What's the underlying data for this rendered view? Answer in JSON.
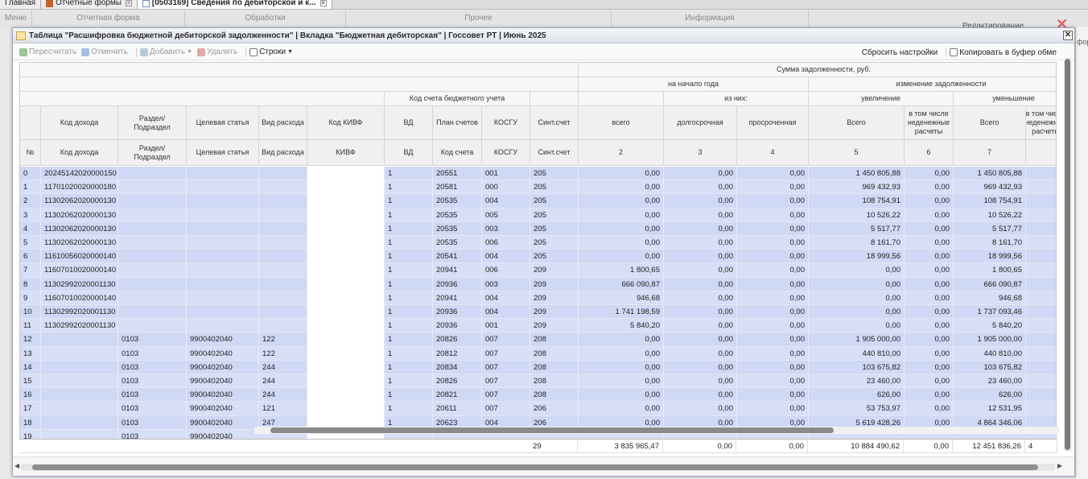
{
  "top_tabs": [
    {
      "label": "Главная",
      "icon": "home-icon"
    },
    {
      "label": "Отчетные формы",
      "icon": "folder-icon"
    },
    {
      "label": "[0503169] Сведения по дебиторской и к...",
      "icon": "document-icon"
    }
  ],
  "menubar": [
    "Меню",
    "Отчетная форма",
    "Обработки",
    "Прочее",
    "Информация"
  ],
  "background": {
    "edit_label": "Редактирование",
    "right_text": "форм"
  },
  "window": {
    "title": "Таблица \"Расшифровка бюджетной дебиторской задолженности\" | Вкладка \"Бюджетная дебиторская\" | Госсовет РТ | Июнь 2025",
    "close_label": "✕"
  },
  "toolbar": {
    "recalc": "Пересчитать",
    "cancel": "Отменить",
    "add": "Добавить",
    "delete": "Удалить",
    "rows": "Строки",
    "reset": "Сбросить настройки",
    "copy": "Копировать в буфер обме"
  },
  "header": {
    "sum_group": "Сумма задолженности, руб.",
    "start_year": "на начало года",
    "change": "изменение задолженности",
    "account_code": "Код счета бюджетного учета",
    "of_which": "из них:",
    "increase": "увеличение",
    "decrease": "уменьшение",
    "cols": [
      "",
      "Код дохода",
      "Раздел/ Подраздел",
      "Целевая статья",
      "Вид расхода",
      "Код КИВФ",
      "ВД",
      "План счетов",
      "КОСГУ",
      "Синт.счет",
      "всего",
      "долгосрочная",
      "просроченная",
      "Всего",
      "в том числе неденежные расчеты",
      "Всего",
      "в том числе неденежные расчеты"
    ],
    "codes": [
      "№",
      "Код дохода",
      "Раздел/ Подраздел",
      "Целевая статья",
      "Вид расхода",
      "КИВФ",
      "ВД",
      "Код счета",
      "КОСГУ",
      "Синт.счет",
      "2",
      "3",
      "4",
      "5",
      "6",
      "7",
      ""
    ]
  },
  "rows": [
    [
      "0",
      "20245142020000150",
      "",
      "",
      "",
      "",
      "1",
      "20551",
      "001",
      "205",
      "0,00",
      "0,00",
      "0,00",
      "1 450 805,88",
      "0,00",
      "1 450 805,88"
    ],
    [
      "1",
      "11701020020000180",
      "",
      "",
      "",
      "",
      "1",
      "20581",
      "000",
      "205",
      "0,00",
      "0,00",
      "0,00",
      "969 432,93",
      "0,00",
      "969 432,93"
    ],
    [
      "2",
      "11302062020000130",
      "",
      "",
      "",
      "",
      "1",
      "20535",
      "004",
      "205",
      "0,00",
      "0,00",
      "0,00",
      "108 754,91",
      "0,00",
      "108 754,91"
    ],
    [
      "3",
      "11302062020000130",
      "",
      "",
      "",
      "",
      "1",
      "20535",
      "005",
      "205",
      "0,00",
      "0,00",
      "0,00",
      "10 526,22",
      "0,00",
      "10 526,22"
    ],
    [
      "4",
      "11302062020000130",
      "",
      "",
      "",
      "",
      "1",
      "20535",
      "003",
      "205",
      "0,00",
      "0,00",
      "0,00",
      "5 517,77",
      "0,00",
      "5 517,77"
    ],
    [
      "5",
      "11302062020000130",
      "",
      "",
      "",
      "",
      "1",
      "20535",
      "006",
      "205",
      "0,00",
      "0,00",
      "0,00",
      "8 161,70",
      "0,00",
      "8 161,70"
    ],
    [
      "6",
      "11610056020000140",
      "",
      "",
      "",
      "",
      "1",
      "20541",
      "004",
      "205",
      "0,00",
      "0,00",
      "0,00",
      "18 999,56",
      "0,00",
      "18 999,56"
    ],
    [
      "7",
      "11607010020000140",
      "",
      "",
      "",
      "",
      "1",
      "20941",
      "006",
      "209",
      "1 800,65",
      "0,00",
      "0,00",
      "0,00",
      "0,00",
      "1 800,65"
    ],
    [
      "8",
      "11302992020001130",
      "",
      "",
      "",
      "",
      "1",
      "20936",
      "003",
      "209",
      "666 090,87",
      "0,00",
      "0,00",
      "0,00",
      "0,00",
      "666 090,87"
    ],
    [
      "9",
      "11607010020000140",
      "",
      "",
      "",
      "",
      "1",
      "20941",
      "004",
      "209",
      "946,68",
      "0,00",
      "0,00",
      "0,00",
      "0,00",
      "946,68"
    ],
    [
      "10",
      "11302992020001130",
      "",
      "",
      "",
      "",
      "1",
      "20936",
      "004",
      "209",
      "1 741 198,59",
      "0,00",
      "0,00",
      "0,00",
      "0,00",
      "1 737 093,46"
    ],
    [
      "11",
      "11302992020001130",
      "",
      "",
      "",
      "",
      "1",
      "20936",
      "001",
      "209",
      "5 840,20",
      "0,00",
      "0,00",
      "0,00",
      "0,00",
      "5 840,20"
    ],
    [
      "12",
      "",
      "0103",
      "9900402040",
      "122",
      "",
      "1",
      "20826",
      "007",
      "208",
      "0,00",
      "0,00",
      "0,00",
      "1 905 000,00",
      "0,00",
      "1 905 000,00"
    ],
    [
      "13",
      "",
      "0103",
      "9900402040",
      "122",
      "",
      "1",
      "20812",
      "007",
      "208",
      "0,00",
      "0,00",
      "0,00",
      "440 810,00",
      "0,00",
      "440 810,00"
    ],
    [
      "14",
      "",
      "0103",
      "9900402040",
      "244",
      "",
      "1",
      "20834",
      "007",
      "208",
      "0,00",
      "0,00",
      "0,00",
      "103 675,82",
      "0,00",
      "103 675,82"
    ],
    [
      "15",
      "",
      "0103",
      "9900402040",
      "244",
      "",
      "1",
      "20826",
      "007",
      "208",
      "0,00",
      "0,00",
      "0,00",
      "23 460,00",
      "0,00",
      "23 460,00"
    ],
    [
      "16",
      "",
      "0103",
      "9900402040",
      "244",
      "",
      "1",
      "20821",
      "007",
      "208",
      "0,00",
      "0,00",
      "0,00",
      "626,00",
      "0,00",
      "626,00"
    ],
    [
      "17",
      "",
      "0103",
      "9900402040",
      "121",
      "",
      "1",
      "20611",
      "007",
      "206",
      "0,00",
      "0,00",
      "0,00",
      "53 753,97",
      "0,00",
      "12 531,95"
    ],
    [
      "18",
      "",
      "0103",
      "9900402040",
      "247",
      "",
      "1",
      "20623",
      "004",
      "206",
      "0,00",
      "0,00",
      "0,00",
      "5 619 428,26",
      "0,00",
      "4 864 346,06"
    ],
    [
      "19",
      "",
      "0103",
      "9900402040",
      "",
      "",
      "",
      "",
      "",
      "",
      "",
      "",
      "",
      "",
      "",
      ""
    ]
  ],
  "totals": {
    "count": "29",
    "vals": [
      "3 835 965,47",
      "0,00",
      "0,00",
      "10 884 490,62",
      "0,00",
      "12 451 836,26"
    ],
    "partial": "4"
  }
}
